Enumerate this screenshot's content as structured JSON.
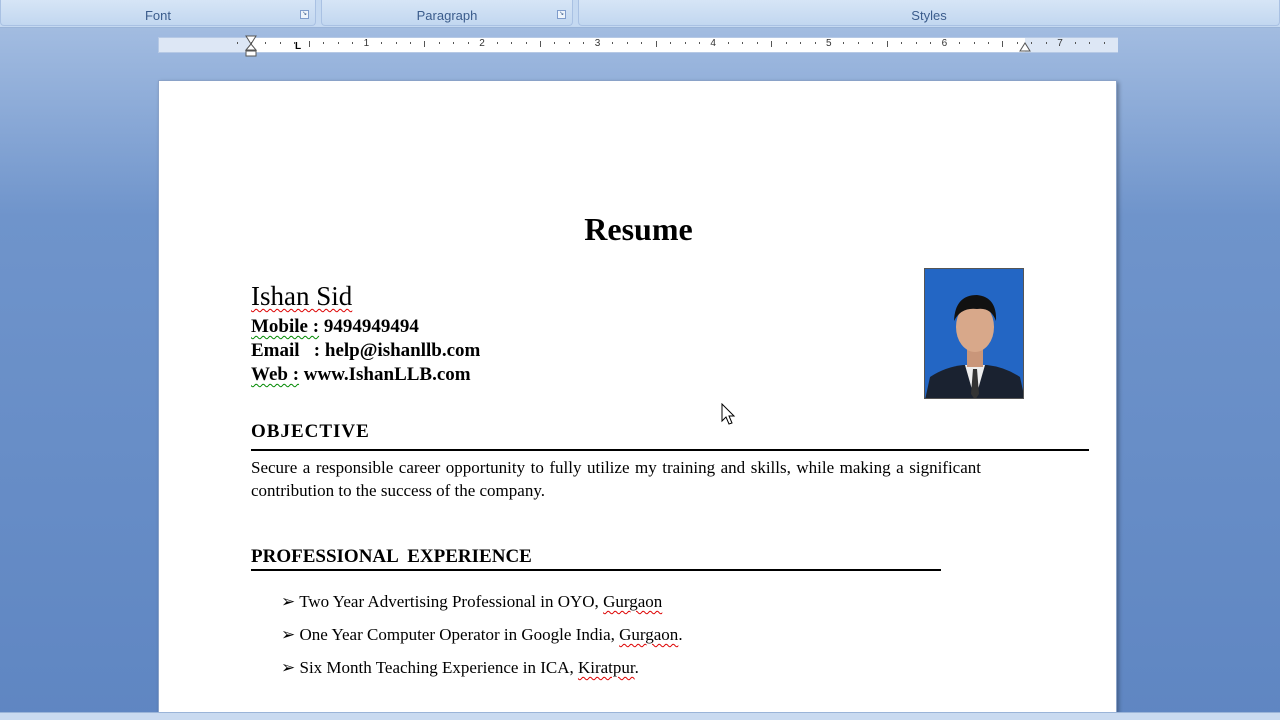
{
  "ribbon": {
    "groups": [
      {
        "label": "Font"
      },
      {
        "label": "Paragraph"
      },
      {
        "label": "Styles"
      }
    ]
  },
  "ruler": {
    "numbers": [
      "1",
      "2",
      "3",
      "4",
      "5",
      "6",
      "7"
    ]
  },
  "document": {
    "title": "Resume",
    "name": "Ishan Sid",
    "mobile_label": "Mobile :",
    "mobile": "9494949494",
    "email_label": "Email   :",
    "email": "help@ishanllb.com",
    "web_label": "Web :",
    "web": "www.IshanLLB.com",
    "objective_heading": "OBJECTIVE",
    "objective_text": "Secure a responsible career opportunity to fully utilize my training and skills, while making a significant contribution to the success of the company.",
    "experience_heading": "PROFESSIONAL  EXPERIENCE",
    "experience": [
      {
        "text": "Two Year Advertising Professional in OYO, ",
        "place": "Gurgaon",
        "end": ""
      },
      {
        "text": "One Year Computer Operator in Google India, ",
        "place": "Gurgaon",
        "end": "."
      },
      {
        "text": "Six Month Teaching Experience in ICA, ",
        "place": "Kiratpur",
        "end": "."
      }
    ],
    "bullet_icon": "arrow-bullet"
  }
}
